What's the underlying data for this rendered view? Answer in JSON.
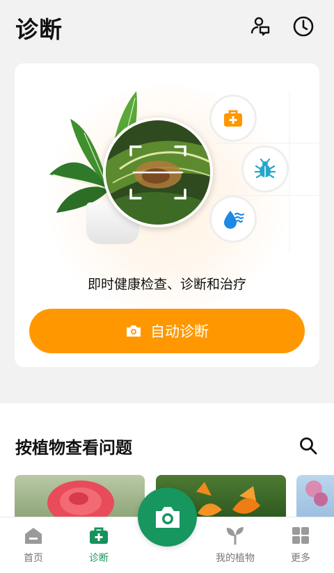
{
  "header": {
    "title": "诊断",
    "profile_icon": "expert-chat-icon",
    "history_icon": "clock-icon"
  },
  "hero": {
    "features": [
      "first-aid-kit-icon",
      "bug-icon",
      "water-drop-icon"
    ],
    "tagline": "即时健康检查、诊断和治疗",
    "cta_label": "自动诊断",
    "cta_icon": "camera-icon"
  },
  "browse": {
    "title": "按植物查看问题",
    "search_icon": "search-icon",
    "thumbnails": [
      "rose",
      "lily",
      "crape-myrtle"
    ]
  },
  "nav": {
    "items": [
      {
        "label": "首页",
        "icon": "home-icon"
      },
      {
        "label": "诊断",
        "icon": "first-aid-kit-icon"
      },
      {
        "label": "我的植物",
        "icon": "sprout-icon"
      },
      {
        "label": "更多",
        "icon": "grid-icon"
      }
    ],
    "center_icon": "camera-icon"
  },
  "colors": {
    "accent_orange": "#ff9800",
    "brand_green": "#17965f",
    "bug_teal": "#26a6c9",
    "water_blue": "#1e88e5"
  }
}
